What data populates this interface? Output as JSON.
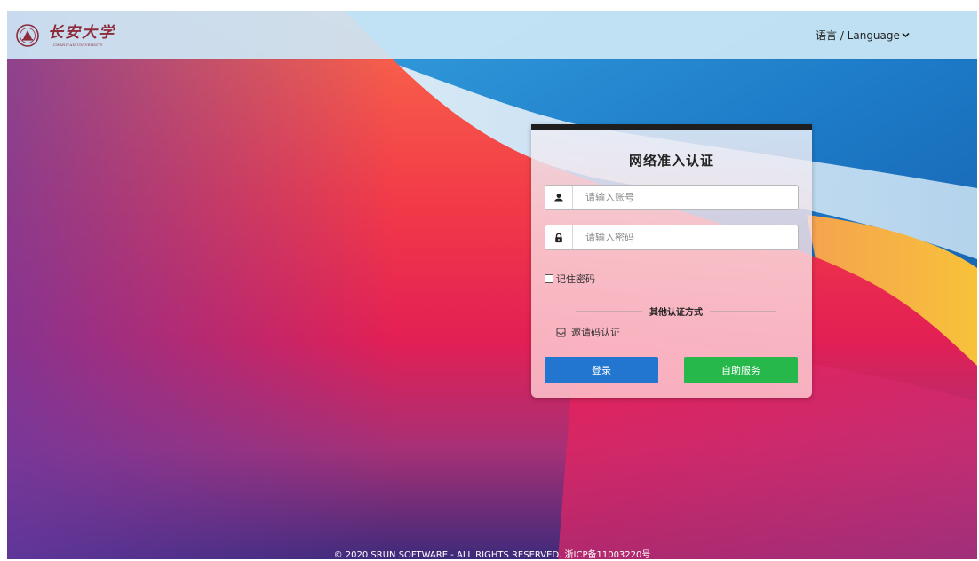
{
  "header": {
    "logo_cn": "长安大学",
    "logo_en": "CHANG'AN UNIVERSITY",
    "language_label": "语言 / Language"
  },
  "login": {
    "title": "网络准入认证",
    "username_placeholder": "请输入账号",
    "password_placeholder": "请输入密码",
    "remember_label": "记住密码",
    "other_methods_label": "其他认证方式",
    "invite_label": "邀请码认证",
    "login_button": "登录",
    "self_service_button": "自助服务"
  },
  "footer": {
    "copyright": "© 2020 SRUN SOFTWARE - ALL RIGHTS RESERVED. 浙ICP备11003220号"
  },
  "colors": {
    "login_button": "#2376d0",
    "self_service_button": "#26b84a",
    "header_bg": "#cde8f6",
    "card_topbar": "#1e1e1e"
  },
  "icons": {
    "logo": "university-seal-icon",
    "language": "chevron-down-icon",
    "username": "user-icon",
    "password": "lock-icon",
    "invite": "inbox-icon"
  }
}
